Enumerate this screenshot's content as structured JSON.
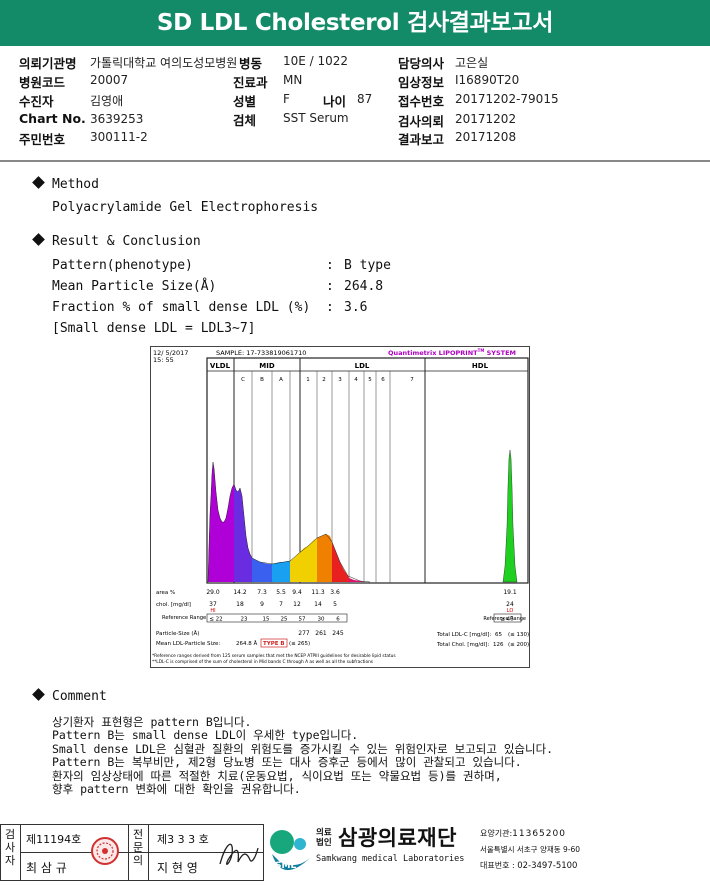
{
  "header": {
    "title": "SD LDL Cholesterol 검사결과보고서"
  },
  "info": {
    "inst_label": "의뢰기관명",
    "inst_value": "가톨릭대학교 여의도성모병원",
    "ward_label": "병동",
    "ward_value": "10E / 1022",
    "doctor_label": "담당의사",
    "doctor_value": "고은실",
    "code_label": "병원코드",
    "code_value": "20007",
    "dept_label": "진료과",
    "dept_value": "MN",
    "clinical_label": "임상정보",
    "clinical_value": "I16890T20",
    "patient_label": "수진자",
    "patient_value": "김영애",
    "sex_label": "성별",
    "sex_value": "F",
    "age_label": "나이",
    "age_value": "87",
    "receipt_label": "접수번호",
    "receipt_value": "20171202-79015",
    "chart_label": "Chart No.",
    "chart_value": "3639253",
    "specimen_label": "검체",
    "specimen_value": "SST Serum",
    "req_label": "검사의뢰",
    "req_value": "20171202",
    "rrn_label": "주민번호",
    "rrn_value": "300111-2",
    "report_label": "결과보고",
    "report_value": "20171208"
  },
  "method": {
    "heading": "Method",
    "text": "Polyacrylamide Gel Electrophoresis"
  },
  "result": {
    "heading": "Result & Conclusion",
    "rows": [
      {
        "label": "Pattern(phenotype)",
        "colon": ":",
        "value": "B type"
      },
      {
        "label": "Mean Particle Size(Å)",
        "colon": ":",
        "value": "264.8"
      },
      {
        "label": "Fraction % of small dense LDL (%)",
        "colon": ":",
        "value": "3.6"
      }
    ],
    "note": "[Small dense LDL = LDL3~7]"
  },
  "chart_data": {
    "type": "area",
    "date": "12/ 5/2017",
    "time": "15: 55",
    "sample": "SAMPLE:  17-733819061710",
    "brand": "Quantimetrix LIPOPRINT",
    "brand_tm": "TM",
    "brand_tail": " SYSTEM",
    "groups": [
      "VLDL",
      "MID",
      "LDL",
      "HDL"
    ],
    "bands": [
      "C",
      "B",
      "A",
      "1",
      "2",
      "3",
      "4",
      "5",
      "6",
      "7"
    ],
    "area_label": "area %",
    "area_values": [
      "29.0",
      "14.2",
      "7.3",
      "5.5",
      "9.4",
      "11.3",
      "3.6",
      "19.1"
    ],
    "chol_label": "chol. [mg/dl]",
    "chol_values": [
      "37",
      "18",
      "9",
      "7",
      "12",
      "14",
      "5",
      "24"
    ],
    "chol_flags": [
      "HI",
      "LO"
    ],
    "ref_label": "Reference Range",
    "ref_values": [
      "≤ 22",
      "23",
      "15",
      "25",
      "57",
      "30",
      "6",
      "≥ 40"
    ],
    "ref_label_right": "Reference Range",
    "particle_label": "Particle-Size (Å)",
    "particle_values": [
      "277",
      "261",
      "245"
    ],
    "mean_label": "Mean LDL-Particle Size:",
    "mean_value": "264.8 Å",
    "mean_type": "TYPE B",
    "mean_ref": "(≤ 265)",
    "total_ldl_label": "Total LDL-C [mg/dl]:",
    "total_ldl_value": "65",
    "total_ldl_ref": "(≤ 130)",
    "total_chol_label": "Total Chol. [mg/dl]:",
    "total_chol_value": "126",
    "total_chol_ref": "(≤ 200)",
    "footnote1": "*Reference ranges derived from 125 serum samples that met the NCEP ATPIII guidelines for desirable lipid status",
    "footnote2": "**LDL-C is comprised of the sum of cholesterol in Mid bands C through A as well as all the subfractions",
    "colors": {
      "vldl": "#b000d8",
      "mid": "#6a2ce0",
      "mid_b": "#3a60f0",
      "ldl1": "#1aa0f0",
      "ldl2": "#f0d000",
      "ldl3": "#f08000",
      "ldl4": "#e82020",
      "ldl5": "#e01070",
      "hdl": "#20d020"
    }
  },
  "comment": {
    "heading": "Comment",
    "lines": [
      "상기환자 표현형은 pattern B입니다.",
      "Pattern B는 small dense LDL이 우세한 type입니다.",
      "Small dense LDL은 심혈관 질환의 위험도를 증가시킬 수 있는 위험인자로 보고되고 있습니다.",
      "Pattern B는 복부비만, 제2형 당뇨병 또는 대사 증후군 등에서 많이 관찰되고 있습니다.",
      "환자의 임상상태에 따른 적절한 치료(운동요법, 식이요법 또는 약물요법 등)를 권하며,",
      "향후 pattern 변화에 대한 확인을 권유합니다."
    ]
  },
  "footer": {
    "examiner_label": "검사자",
    "examiner_no": "제11194호",
    "examiner_name": "최 삼 규",
    "specialist_label": "전문의",
    "specialist_no": "제3 3 3 호",
    "specialist_name": "지 현 영",
    "org_prefix": "의료 법인",
    "org_name": "삼광의료재단",
    "org_en": "Samkwang medical Laboratories",
    "logo_text": "SML",
    "code_label": "요양기관:",
    "code_value": "11365200",
    "address": "서울특별시 서초구 양재동 9-60",
    "tel_label": "대표번호 :",
    "tel_value": "02-3497-5100"
  }
}
